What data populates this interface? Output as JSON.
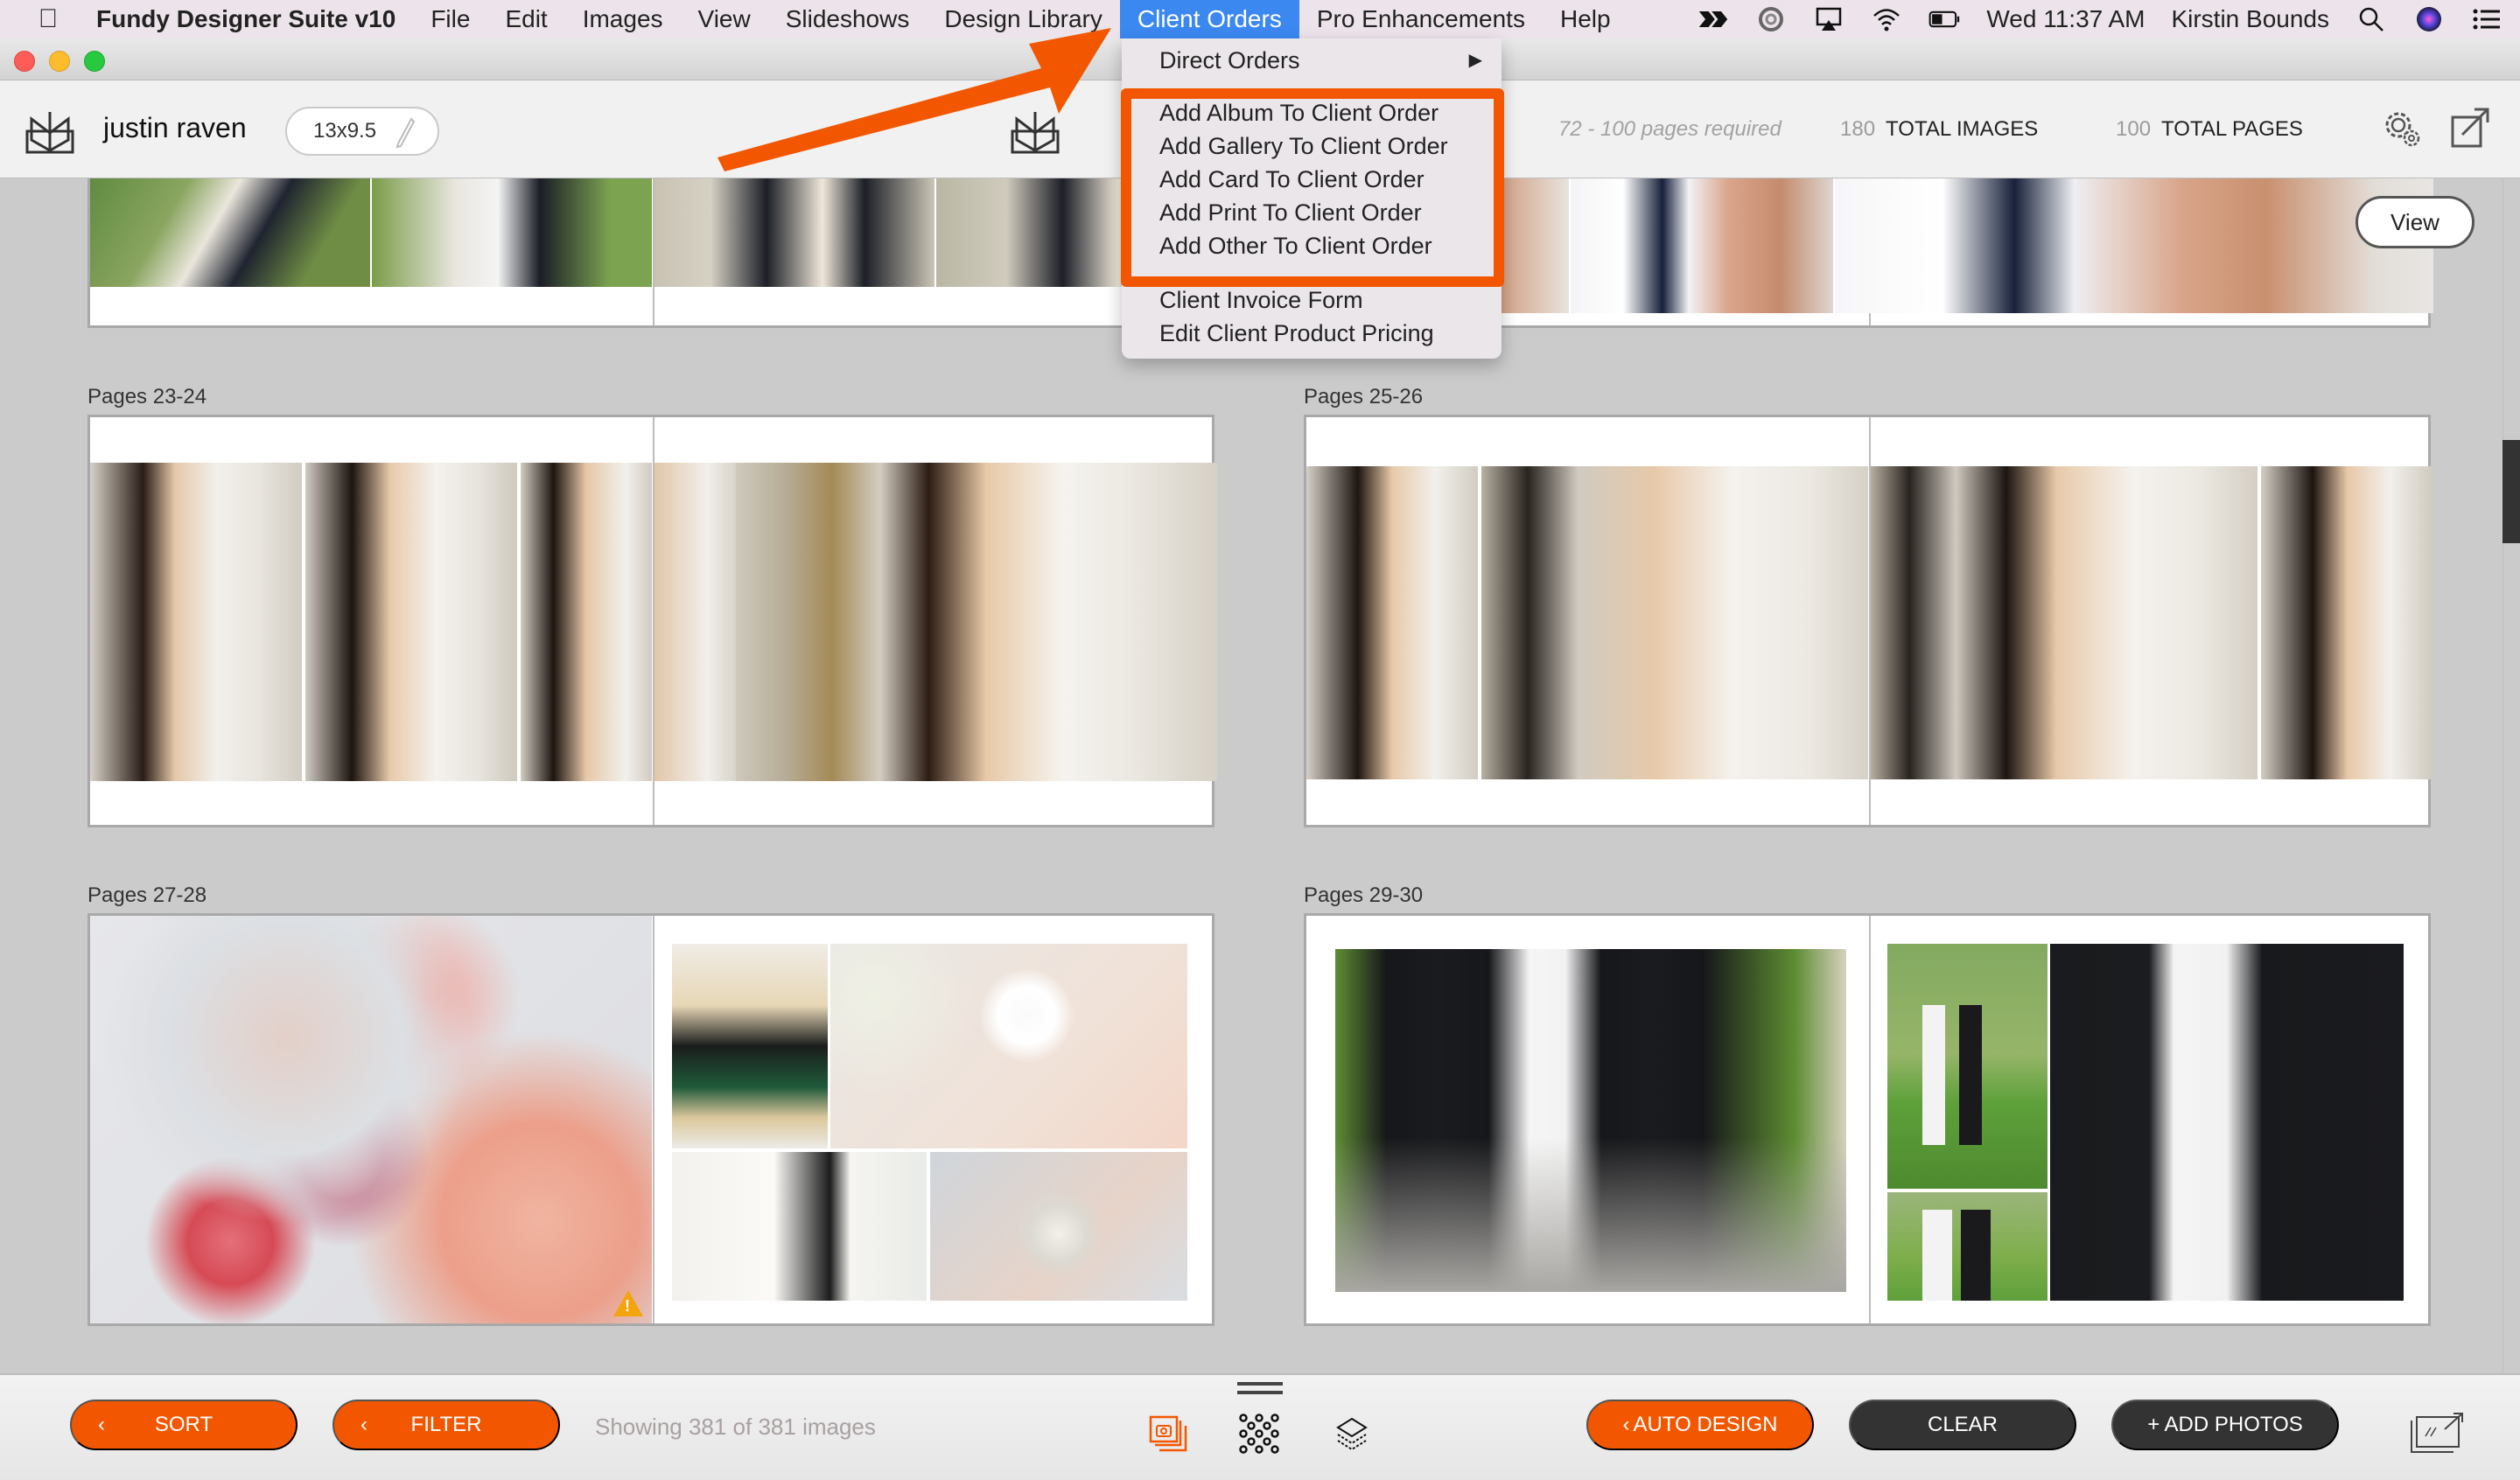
{
  "menubar": {
    "app_name": "Fundy Designer Suite v10",
    "items": [
      "File",
      "Edit",
      "Images",
      "View",
      "Slideshows",
      "Design Library",
      "Client Orders",
      "Pro Enhancements",
      "Help"
    ],
    "active_item": "Client Orders",
    "status_icons": [
      "bitbar-icon",
      "creative-cloud-icon",
      "airplay-icon",
      "wifi-icon",
      "battery-icon"
    ],
    "clock": "Wed 11:37 AM",
    "user": "Kirstin Bounds"
  },
  "header": {
    "client_name": "justin raven",
    "album_size": "13x9.5",
    "pages_required": "72 - 100 pages required",
    "total_images_count": "180",
    "total_images_label": "TOTAL IMAGES",
    "total_pages_count": "100",
    "total_pages_label": "TOTAL PAGES"
  },
  "content": {
    "view_button": "View",
    "spreads": [
      {
        "label": "Pages 23-24"
      },
      {
        "label": "Pages 25-26"
      },
      {
        "label": "Pages 27-28",
        "warning": true
      },
      {
        "label": "Pages 29-30"
      }
    ]
  },
  "dropdown": {
    "title": "Client Orders",
    "items": [
      {
        "label": "Direct Orders",
        "submenu": true
      },
      {
        "label": "Add Album To Client Order",
        "highlighted": true
      },
      {
        "label": "Add Gallery To Client Order",
        "highlighted": true
      },
      {
        "label": "Add Card To Client Order",
        "highlighted": true
      },
      {
        "label": "Add Print To Client Order",
        "highlighted": true
      },
      {
        "label": "Add Other To Client Order",
        "highlighted": true
      },
      {
        "label": "Client Invoice Form"
      },
      {
        "label": "Edit Client Product Pricing"
      }
    ]
  },
  "bottombar": {
    "sort_label": "SORT",
    "filter_label": "FILTER",
    "showing_text": "Showing 381 of 381 images",
    "auto_design_label": "AUTO DESIGN",
    "clear_label": "CLEAR",
    "add_photos_label": "+ ADD PHOTOS"
  },
  "colors": {
    "accent": "#f25700",
    "menu_active": "#3b88f0",
    "dark_button": "#333333"
  }
}
